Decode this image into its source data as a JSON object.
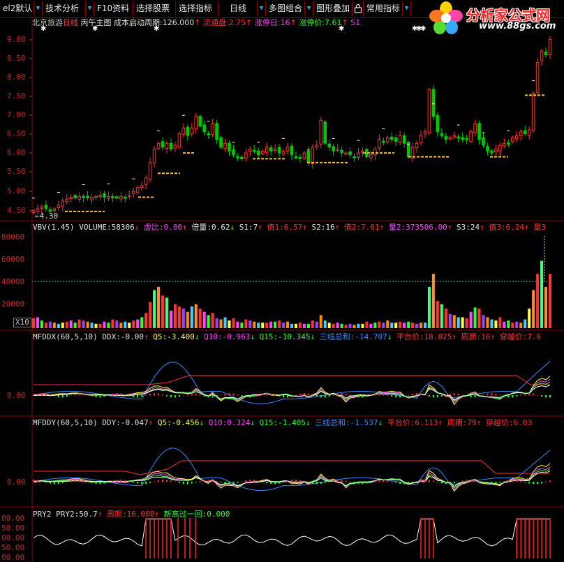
{
  "toolbar": {
    "items": [
      "el2默认",
      "技术分析",
      "F10资料",
      "选择股票",
      "选择指标",
      "日线",
      "多图组合",
      "图形叠加",
      "常用指标"
    ],
    "lock_icon": "lock-icon"
  },
  "logo": {
    "title": "分析家公式网",
    "url": "www.88gs.com",
    "icon": "flower-icon"
  },
  "panel1": {
    "stock": "北京旅游",
    "period": "日线",
    "name": "丙午主图",
    "cb_label": "成本启动周期:",
    "cb_value": "126.000",
    "lt_label": "流通盘:",
    "lt_value": "2.75",
    "zt_label": "涨停日:",
    "zt_value": "16",
    "ztj_label": "涨停价:",
    "ztj_value": "7.61",
    "s1": "S1",
    "low_label": "←4.30",
    "yticks": [
      "9.00",
      "8.50",
      "8.00",
      "7.50",
      "7.00",
      "6.50",
      "6.00",
      "5.50",
      "5.00",
      "4.50"
    ],
    "colors": {
      "up": "#ff3333",
      "down": "#00c800",
      "support": "#ffc040"
    }
  },
  "panel2": {
    "name": "VBV(1.45)",
    "vol_label": "VOLUME:",
    "vol_value": "58306",
    "xb_label": "虚比:",
    "xb_value": "0.00",
    "bl_label": "倍量:",
    "bl_value": "0.62",
    "s1_label": "S1:",
    "s1_value": "7",
    "z1_label": "值1:",
    "z1_value": "6.57",
    "s2_label": "S2:",
    "s2_value": "16",
    "z2_label": "值2:",
    "z2_value": "7.61",
    "l2_label": "量2:",
    "l2_value": "373506.00",
    "s3_label": "S3:",
    "s3_value": "24",
    "z3_label": "值3:",
    "z3_value": "6.24",
    "l3_label": "量3",
    "yticks": [
      "80000",
      "60000",
      "40000",
      "20000"
    ],
    "x10": "X10"
  },
  "panel3": {
    "name": "MFDDX(60,5,10)",
    "ddx_label": "DDX:",
    "ddx_value": "-0.00",
    "q5_label": "Q5:",
    "q5_value": "-3.400",
    "q10_label": "Q10:",
    "q10_value": "-0.963",
    "q15_label": "Q15:",
    "q15_value": "-10.345",
    "sum_label": "三线总和:",
    "sum_value": "-14.707",
    "ptj_label": "平台价:",
    "ptj_value": "18.825",
    "zq_label": "周期:",
    "zq_value": "16",
    "cyj_label": "穿越价:",
    "cyj_value": "7.6",
    "yticks": [
      "0.00"
    ]
  },
  "panel4": {
    "name": "MFDDY(60,5,10)",
    "ddy_label": "DDY:",
    "ddy_value": "-0.047",
    "q5_label": "Q5:",
    "q5_value": "-0.456",
    "q10_label": "Q10:",
    "q10_value": "0.324",
    "q15_label": "Q15:",
    "q15_value": "-1.405",
    "sum_label": "三线总和:",
    "sum_value": "-1.537",
    "ptj_label": "平台价:",
    "ptj_value": "6.113",
    "zq_label": "周期:",
    "zq_value": "79",
    "cyj_label": "穿越价:",
    "cyj_value": "6.03",
    "yticks": [
      "0.00"
    ]
  },
  "panel5": {
    "name": "PRY2",
    "pry2_label": "PRY2:",
    "pry2_value": "50.7",
    "zq_label": "周期:",
    "zq_value": "16.000",
    "xg_label": "新高过一回:",
    "xg_value": "0.000",
    "yticks": [
      "00.00",
      "50.00",
      "00.00",
      "50.00",
      "00.00"
    ]
  },
  "chart_data": {
    "type": "candlestick",
    "title": "北京旅游 日线",
    "ylim": [
      4.3,
      9.2
    ],
    "close": [
      4.45,
      4.5,
      4.55,
      4.5,
      4.45,
      4.5,
      4.6,
      4.7,
      4.75,
      4.8,
      4.78,
      4.82,
      4.8,
      4.78,
      4.8,
      4.82,
      4.85,
      4.8,
      4.82,
      4.78,
      4.8,
      4.82,
      4.8,
      4.85,
      4.95,
      5.05,
      5.1,
      5.3,
      5.7,
      6.05,
      6.2,
      6.1,
      6.2,
      6.05,
      6.15,
      6.45,
      6.6,
      6.4,
      6.6,
      6.9,
      6.65,
      6.5,
      6.45,
      6.7,
      6.3,
      6.1,
      6.2,
      6.0,
      5.9,
      5.85,
      5.8,
      5.95,
      6.05,
      6.0,
      5.9,
      6.0,
      6.1,
      6.0,
      6.05,
      5.95,
      6.0,
      6.1,
      5.9,
      5.85,
      5.8,
      5.95,
      5.7,
      6.1,
      6.15,
      6.8,
      6.2,
      6.1,
      6.0,
      6.05,
      5.95,
      5.95,
      5.9,
      5.85,
      5.95,
      6.0,
      5.85,
      5.9,
      6.05,
      6.3,
      6.25,
      6.35,
      6.3,
      6.25,
      6.4,
      6.2,
      5.85,
      6.1,
      6.2,
      6.4,
      6.5,
      7.6,
      6.9,
      6.5,
      6.4,
      6.3,
      6.35,
      6.4,
      6.35,
      6.3,
      6.3,
      6.5,
      6.7,
      6.3,
      6.15,
      6.0,
      5.95,
      6.05,
      6.15,
      6.2,
      6.2,
      6.35,
      6.4,
      6.5,
      6.45,
      6.55,
      7.5,
      8.3,
      8.6,
      8.5,
      8.9
    ],
    "volume": [
      9000,
      10000,
      7000,
      5000,
      6000,
      5000,
      4000,
      5000,
      6000,
      7000,
      5000,
      8000,
      7000,
      6000,
      5000,
      4000,
      4000,
      6000,
      5000,
      8000,
      7000,
      5000,
      6000,
      5000,
      7000,
      8000,
      10000,
      14000,
      24000,
      35000,
      38000,
      30000,
      28000,
      16000,
      22000,
      20000,
      18000,
      15000,
      20000,
      22000,
      18000,
      15000,
      12000,
      14000,
      9000,
      8000,
      10000,
      7000,
      9000,
      6000,
      5000,
      8000,
      7000,
      6000,
      5000,
      5000,
      5000,
      6000,
      6000,
      7000,
      5000,
      6000,
      4000,
      4000,
      5000,
      4000,
      4000,
      7000,
      6000,
      12000,
      7000,
      5000,
      4000,
      5000,
      4000,
      3000,
      4000,
      3000,
      4000,
      4000,
      6000,
      4000,
      5000,
      6000,
      5000,
      7000,
      5000,
      5000,
      6000,
      5000,
      6000,
      5000,
      4000,
      5000,
      5000,
      38000,
      50000,
      25000,
      22000,
      18000,
      13000,
      12000,
      10000,
      10000,
      9000,
      15000,
      19000,
      18000,
      12000,
      10000,
      8000,
      7000,
      10000,
      6000,
      7000,
      5000,
      6000,
      5000,
      8000,
      18000,
      35000,
      50000,
      62000,
      38000,
      50000
    ]
  }
}
